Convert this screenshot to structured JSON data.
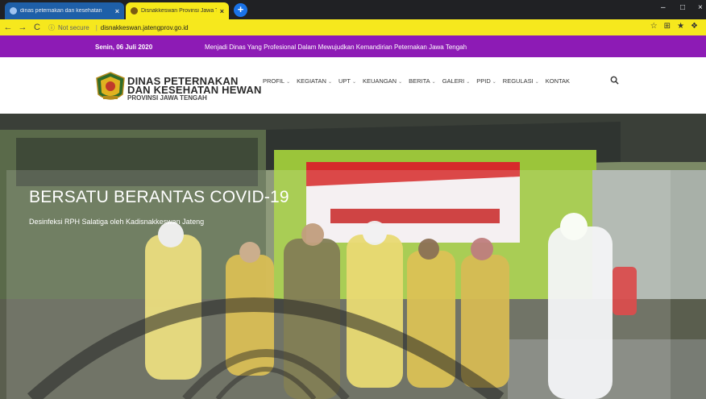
{
  "browser": {
    "tabs": [
      {
        "title": "dinas peternakan dan kesehatan",
        "close": "×"
      },
      {
        "title": "Disnakkeswan Provinsi Jawa Ten",
        "close": "×"
      }
    ],
    "new_tab": "+",
    "window_controls": {
      "minimize": "–",
      "maximize": "□",
      "close": "×"
    },
    "address": {
      "security": "Not secure",
      "url": "disnakkeswan.jatengprov.go.id"
    },
    "nav": {
      "back": "←",
      "forward": "→",
      "reload": "C"
    },
    "extras": [
      "☆",
      "⊞",
      "★",
      "❖"
    ]
  },
  "topbar": {
    "date": "Senin, 06 Juli 2020",
    "tagline": "Menjadi Dinas Yang Profesional Dalam Mewujudkan Kemandirian Peternakan Jawa Tengah"
  },
  "logo": {
    "line1": "DINAS PETERNAKAN",
    "line2": "DAN KESEHATAN HEWAN",
    "line3": "PROVINSI JAWA TENGAH"
  },
  "menu": [
    {
      "label": "PROFIL",
      "dropdown": true
    },
    {
      "label": "KEGIATAN",
      "dropdown": true
    },
    {
      "label": "UPT",
      "dropdown": true
    },
    {
      "label": "KEUANGAN",
      "dropdown": true
    },
    {
      "label": "BERITA",
      "dropdown": true
    },
    {
      "label": "GALERI",
      "dropdown": true
    },
    {
      "label": "PPID",
      "dropdown": true
    },
    {
      "label": "REGULASI",
      "dropdown": true
    },
    {
      "label": "KONTAK",
      "dropdown": false
    }
  ],
  "hero": {
    "title": "BERSATU BERANTAS COVID-19",
    "subtitle": "Desinfeksi RPH Salatiga oleh Kadisnakkeswan Jateng"
  },
  "colors": {
    "purple": "#8d1bb5",
    "chrome_yellow": "#f6e81d",
    "tab_blue": "#1e5fa8"
  }
}
